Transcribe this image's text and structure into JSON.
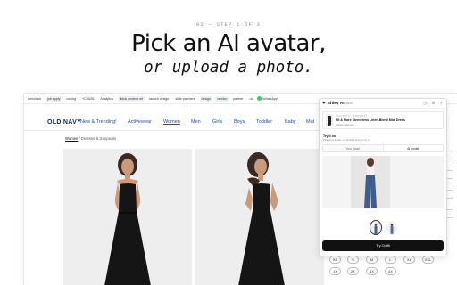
{
  "hero": {
    "step": "02 — STEP 1 OF 3",
    "title": "Pick an AI avatar,",
    "subtitle": "or upload a photo."
  },
  "bookmarks": [
    {
      "label": "merchant",
      "tag": false
    },
    {
      "label": "job apply",
      "tag": true
    },
    {
      "label": "coding",
      "tag": false
    },
    {
      "label": "YC W26",
      "tag": false
    },
    {
      "label": "Analytics",
      "tag": false
    },
    {
      "label": "tiktok content ref",
      "tag": true
    },
    {
      "label": "launch design",
      "tag": false
    },
    {
      "label": "slide payment",
      "tag": false
    },
    {
      "label": "design",
      "tag": true
    },
    {
      "label": "vendor",
      "tag": true
    },
    {
      "label": "partner",
      "tag": false
    },
    {
      "label": "ux",
      "tag": false
    }
  ],
  "whatsapp_label": "WhatsApp",
  "store": {
    "logo": "OLD NAVY",
    "nav": [
      "New & Trending!",
      "Activewear",
      "Women",
      "Men",
      "Girls",
      "Boys",
      "Toddler",
      "Baby",
      "Mat"
    ],
    "active_nav": "Women",
    "breadcrumb_root": "Women",
    "breadcrumb_rest": " / Dresses & Jumpsuits"
  },
  "sizes": [
    "XS",
    "S",
    "M",
    "L",
    "XL",
    "XXL",
    "1X",
    "2X",
    "3X",
    "4X"
  ],
  "panel": {
    "name": "Shley AI",
    "badge": "BETA",
    "product_brand": "OLD NAVY · PRODUCT",
    "product_title": "Fit & Flare Sleeveless Linen-Blend Midi Dress",
    "product_source": "oldnavy.gap.com",
    "try_label": "Try it on",
    "try_hint": "Pick an AI avatar, or upload a photo to try on.",
    "modes": [
      "Your photo",
      "AI model"
    ],
    "active_mode": "AI model",
    "button_label": "Try Outfit"
  },
  "colors": {
    "brand_navy": "#0f2a5b",
    "nav_link": "#1c4fa1",
    "button_bg": "#111111"
  }
}
